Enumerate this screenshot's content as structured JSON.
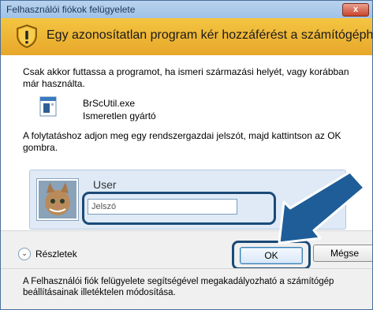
{
  "window": {
    "title": "Felhasználói fiókok felügyelete",
    "close_label": "x"
  },
  "banner": {
    "headline": "Egy azonosítatlan program kér hozzáférést a számítógéphez",
    "shield_icon": "shield-warning-icon"
  },
  "content": {
    "intro": "Csak akkor futtassa a programot, ha ismeri származási helyét, vagy korábban már használta.",
    "app": {
      "name": "BrScUtil.exe",
      "publisher": "Ismeretlen gyártó"
    },
    "instruction": "A folytatáshoz adjon meg egy rendszergazdai jelszót, majd kattintson az OK gombra."
  },
  "credential": {
    "username": "User",
    "password_placeholder": "Jelszó",
    "password_value": ""
  },
  "buttons": {
    "details": "Részletek",
    "ok": "OK",
    "cancel": "Mégse"
  },
  "footer": {
    "text": "A Felhasználói fiók felügyelete segítségével megakadályozható a számítógép beállításainak illetéktelen módosítása."
  },
  "colors": {
    "banner": "#f0b83a",
    "highlight": "#1a4a78",
    "arrow": "#1f5d99"
  }
}
